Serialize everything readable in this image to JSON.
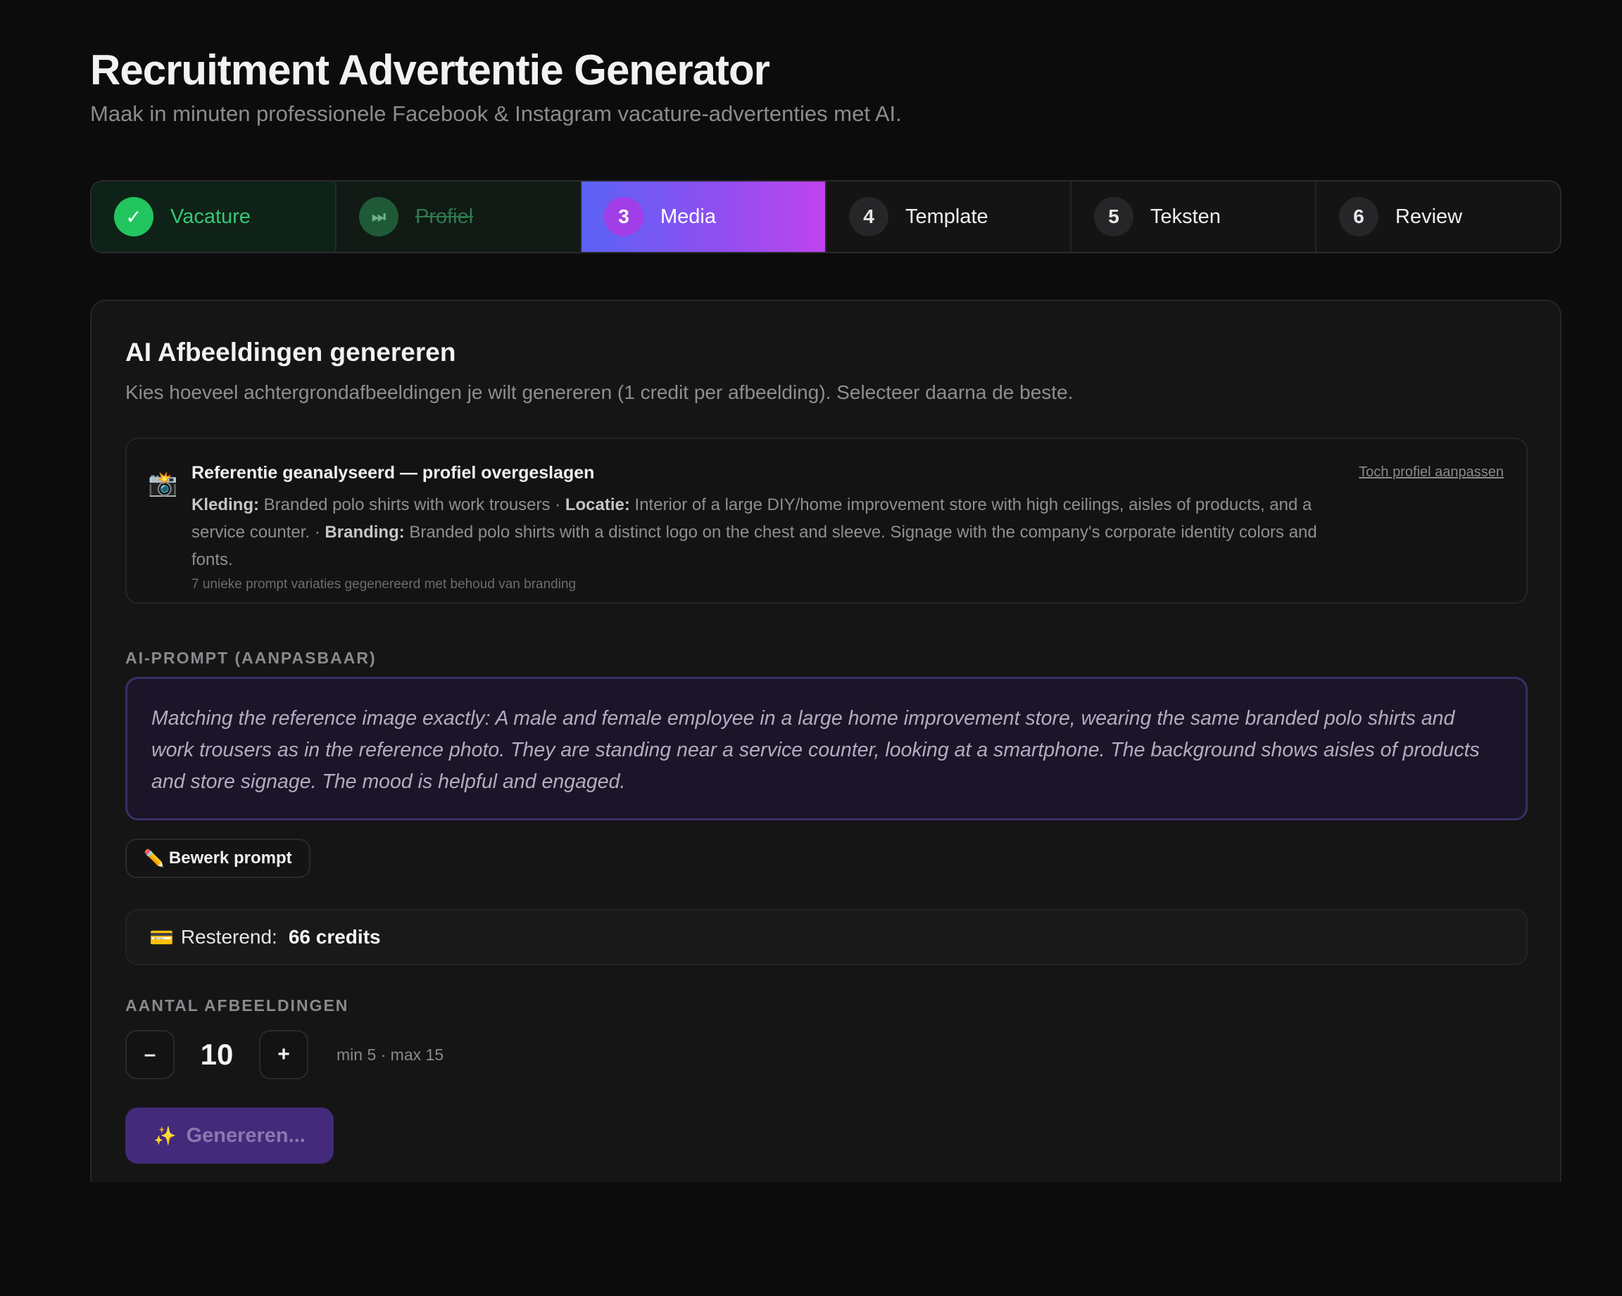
{
  "header": {
    "title": "Recruitment Advertentie Generator",
    "subtitle": "Maak in minuten professionele Facebook & Instagram vacature-advertenties met AI."
  },
  "steps": [
    {
      "num": "✓",
      "label": "Vacature",
      "state": "done"
    },
    {
      "num": "⏭",
      "label": "Profiel",
      "state": "skipped"
    },
    {
      "num": "3",
      "label": "Media",
      "state": "active"
    },
    {
      "num": "4",
      "label": "Template",
      "state": "pending"
    },
    {
      "num": "5",
      "label": "Teksten",
      "state": "pending"
    },
    {
      "num": "6",
      "label": "Review",
      "state": "pending"
    }
  ],
  "section": {
    "title": "AI Afbeeldingen genereren",
    "description": "Kies hoeveel achtergrondafbeeldingen je wilt genereren (1 credit per afbeelding). Selecteer daarna de beste."
  },
  "reference": {
    "icon": "camera-flash-icon",
    "title": "Referentie geanalyseerd — profiel overgeslagen",
    "link": "Toch profiel aanpassen",
    "clothing_label": "Kleding:",
    "clothing": "Branded polo shirts with work trousers",
    "location_label": "Locatie:",
    "location": "Interior of a large DIY/home improvement store with high ceilings, aisles of products, and a service counter.",
    "branding_label": "Branding:",
    "branding": "Branded polo shirts with a distinct logo on the chest and sleeve. Signage with the company's corporate identity colors and fonts.",
    "separator": " · ",
    "note": "7 unieke prompt variaties gegenereerd met behoud van branding"
  },
  "prompt": {
    "label": "AI-PROMPT (AANPASBAAR)",
    "text": "Matching the reference image exactly: A male and female employee in a large home improvement store, wearing the same branded polo shirts and work trousers as in the reference photo. They are standing near a service counter, looking at a smartphone. The background shows aisles of products and store signage. The mood is helpful and engaged.",
    "edit_icon": "✏️",
    "edit_label": "Bewerk prompt"
  },
  "credits": {
    "icon": "💳",
    "label": "Resterend:",
    "value": "66 credits"
  },
  "quantity": {
    "label": "AANTAL AFBEELDINGEN",
    "decrement": "–",
    "increment": "+",
    "value": "10",
    "hint": "min 5 · max 15"
  },
  "generate": {
    "icon": "✨",
    "label": "Genereren..."
  },
  "colors": {
    "accent_start": "#5b63f5",
    "accent_end": "#c044ef",
    "success": "#22c55e",
    "background": "#0c0c0d"
  }
}
